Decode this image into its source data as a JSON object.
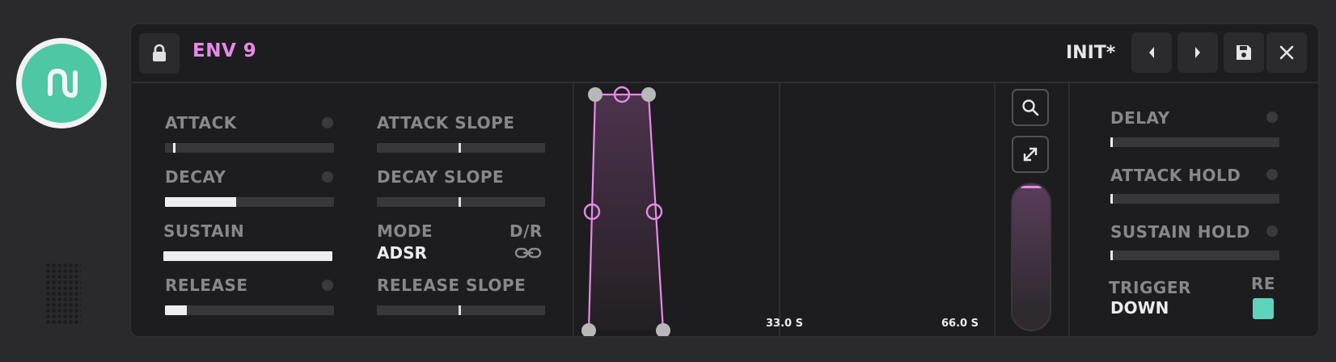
{
  "header": {
    "title": "ENV 9",
    "preset_name": "INIT*",
    "icons": {
      "lock": "lock-icon",
      "prev": "chevron-left-icon",
      "next": "chevron-right-icon",
      "save": "save-icon",
      "close": "close-icon"
    }
  },
  "colors": {
    "accent": "#e889e8",
    "teal": "#4dc7a4",
    "trigger": "#5ed4bd",
    "panel": "#1d1d1f",
    "background": "#2a2a2d"
  },
  "left": {
    "attack": {
      "label": "ATTACK",
      "value": 0.06
    },
    "decay": {
      "label": "DECAY",
      "value": 0.42
    },
    "sustain": {
      "label": "SUSTAIN",
      "value": 1.0
    },
    "release": {
      "label": "RELEASE",
      "value": 0.13
    }
  },
  "slopes": {
    "attack_slope": {
      "label": "ATTACK SLOPE",
      "value": 0.5
    },
    "decay_slope": {
      "label": "DECAY SLOPE",
      "value": 0.5
    },
    "release_slope": {
      "label": "RELEASE SLOPE",
      "value": 0.5
    },
    "mode_label": "MODE",
    "mode_value": "ADSR",
    "dr_label": "D/R",
    "dr_icon": "link-icon"
  },
  "graph": {
    "time_labels": [
      "33.0 S",
      "66.0 S"
    ],
    "zoom_icon": "search-icon",
    "expand_icon": "expand-icon"
  },
  "right": {
    "delay": {
      "label": "DELAY",
      "value": 0.0
    },
    "attack_hold": {
      "label": "ATTACK HOLD",
      "value": 0.0
    },
    "sustain_hold": {
      "label": "SUSTAIN HOLD",
      "value": 0.0
    },
    "trigger_label": "TRIGGER",
    "trigger_value": "DOWN",
    "re_label": "RE",
    "re_enabled": true
  }
}
